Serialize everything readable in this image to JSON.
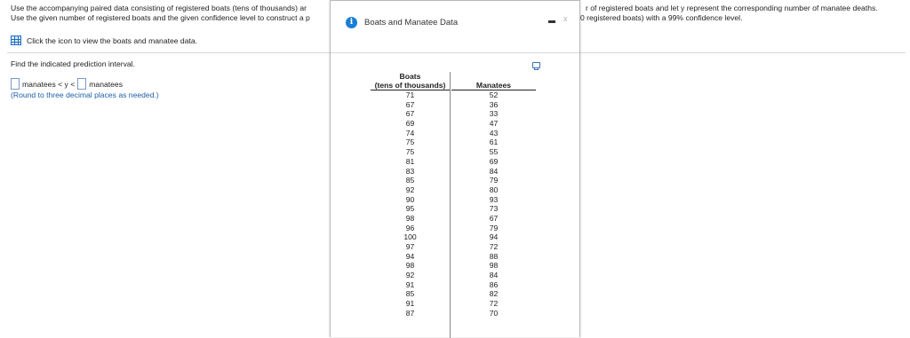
{
  "question": {
    "line1_left": "Use the accompanying paired data consisting of registered boats (tens of thousands) ar",
    "line2_left": "Use the given number of registered boats and the given confidence level to construct a p",
    "line1_right": "r of registered boats and let y represent the corresponding number of manatee deaths.",
    "line2_right": "0 registered boats) with a 99% confidence level.",
    "icon_link_label": "Click the icon to view the boats and manatee data.",
    "find_label": "Find the indicated prediction interval.",
    "answer_left_text": "manatees < y <",
    "answer_right_text": "manatees",
    "round_note": "(Round to three decimal places as needed.)"
  },
  "dialog": {
    "title": "Boats and Manatee Data",
    "info_glyph": "i",
    "close_glyph": "x",
    "table": {
      "boats_header_line1": "Boats",
      "boats_header_line2": "(tens of thousands)",
      "manatees_header": "Manatees",
      "boats": [
        "71",
        "67",
        "67",
        "69",
        "74",
        "75",
        "75",
        "81",
        "83",
        "85",
        "92",
        "90",
        "95",
        "98",
        "96",
        "100",
        "97",
        "94",
        "98",
        "92",
        "91",
        "85",
        "91",
        "87"
      ],
      "manatees": [
        "52",
        "36",
        "33",
        "47",
        "43",
        "61",
        "55",
        "69",
        "84",
        "79",
        "80",
        "93",
        "73",
        "67",
        "79",
        "94",
        "72",
        "88",
        "98",
        "84",
        "86",
        "82",
        "72",
        "70"
      ]
    }
  },
  "colors": {
    "info_icon": "#1a7fd4",
    "round_note": "#1f5fa8",
    "answer_box_border": "#7a9cc6"
  },
  "icons": [
    "table-icon",
    "info-icon",
    "minimize-icon",
    "close-icon",
    "copy-icon"
  ]
}
